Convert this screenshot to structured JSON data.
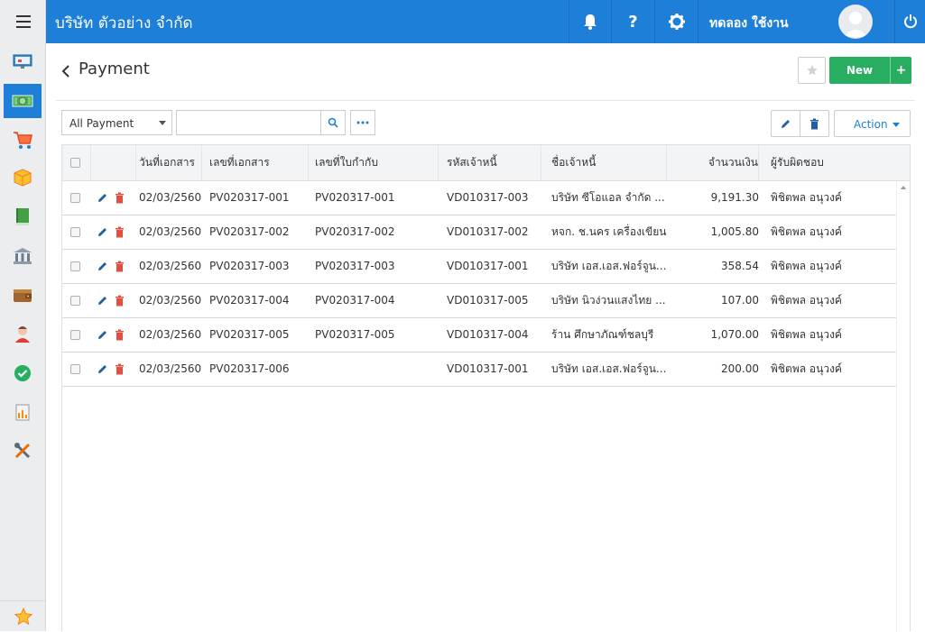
{
  "app": {
    "company_name": "บริษัท ตัวอย่าง จำกัด",
    "user_name": "ทดลอง ใช้งาน",
    "accent_color": "#1d7fd8",
    "green_color": "#27ae60"
  },
  "sidebar": {
    "items": [
      {
        "name": "dashboard-icon"
      },
      {
        "name": "money-icon",
        "active": true
      },
      {
        "name": "cart-icon"
      },
      {
        "name": "box-icon"
      },
      {
        "name": "book-icon"
      },
      {
        "name": "bank-icon"
      },
      {
        "name": "wallet-icon"
      },
      {
        "name": "person-icon"
      },
      {
        "name": "check-icon"
      },
      {
        "name": "report-icon"
      },
      {
        "name": "tools-icon"
      }
    ],
    "favorite": "star-icon"
  },
  "page": {
    "title": "Payment",
    "new_label": "New",
    "plus_label": "+"
  },
  "toolbar": {
    "filter_value": "All Payment",
    "search_placeholder": "",
    "action_label": "Action"
  },
  "table": {
    "columns": [
      "วันที่เอกสาร",
      "เลขที่เอกสาร",
      "เลขที่ใบกำกับ",
      "รหัสเจ้าหนี้",
      "ชื่อเจ้าหนี้",
      "จำนวนเงิน",
      "ผู้รับผิดชอบ"
    ],
    "rows": [
      {
        "date": "02/03/2560",
        "doc_no": "PV020317-001",
        "invoice_no": "PV020317-001",
        "creditor_code": "VD010317-003",
        "creditor_name": "บริษัท ซีโอแอล จำกัด ...",
        "amount": "9,191.30",
        "owner": "พิชิตพล อนุวงค์"
      },
      {
        "date": "02/03/2560",
        "doc_no": "PV020317-002",
        "invoice_no": "PV020317-002",
        "creditor_code": "VD010317-002",
        "creditor_name": "หจก. ช.นคร เครื่องเขียน",
        "amount": "1,005.80",
        "owner": "พิชิตพล อนุวงค์"
      },
      {
        "date": "02/03/2560",
        "doc_no": "PV020317-003",
        "invoice_no": "PV020317-003",
        "creditor_code": "VD010317-001",
        "creditor_name": "บริษัท เอส.เอส.ฟอร์จูน...",
        "amount": "358.54",
        "owner": "พิชิตพล อนุวงค์"
      },
      {
        "date": "02/03/2560",
        "doc_no": "PV020317-004",
        "invoice_no": "PV020317-004",
        "creditor_code": "VD010317-005",
        "creditor_name": "บริษัท นิวง่วนแสงไทย ...",
        "amount": "107.00",
        "owner": "พิชิตพล อนุวงค์"
      },
      {
        "date": "02/03/2560",
        "doc_no": "PV020317-005",
        "invoice_no": "PV020317-005",
        "creditor_code": "VD010317-004",
        "creditor_name": "ร้าน ศึกษาภัณฑ์ชลบุรี",
        "amount": "1,070.00",
        "owner": "พิชิตพล อนุวงค์"
      },
      {
        "date": "02/03/2560",
        "doc_no": "PV020317-006",
        "invoice_no": "",
        "creditor_code": "VD010317-001",
        "creditor_name": "บริษัท เอส.เอส.ฟอร์จูน...",
        "amount": "200.00",
        "owner": "พิชิตพล อนุวงค์"
      }
    ]
  }
}
